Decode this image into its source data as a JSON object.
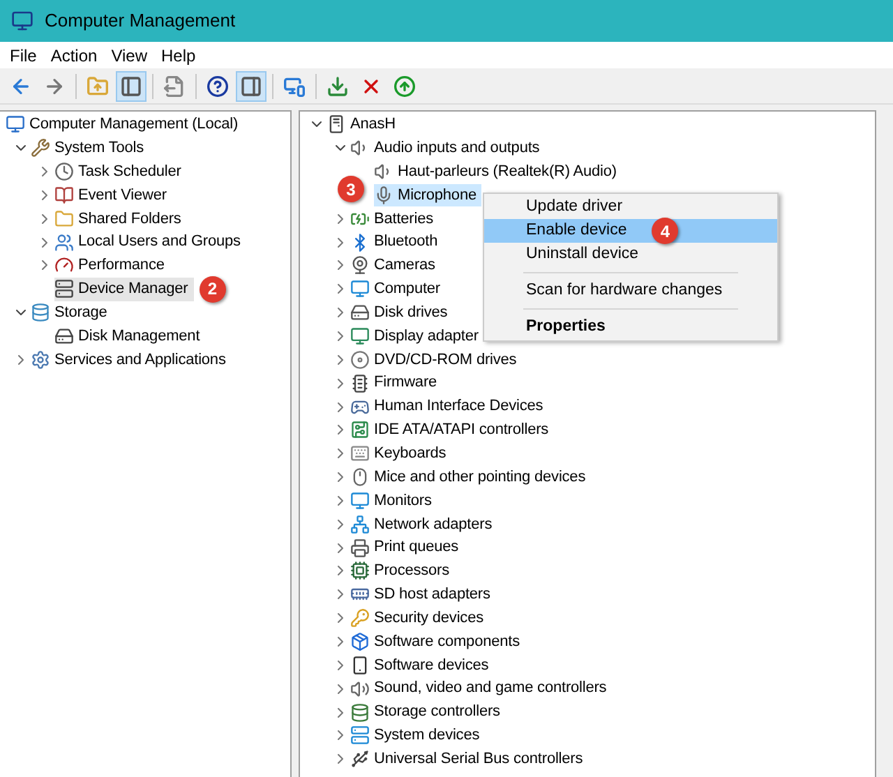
{
  "window": {
    "title": "Computer Management"
  },
  "menu": [
    "File",
    "Action",
    "View",
    "Help"
  ],
  "toolbar": [
    {
      "pressed": false
    },
    {
      "pressed": false
    },
    {
      "pressed": false
    },
    {
      "pressed": true
    },
    {
      "pressed": false
    },
    {
      "pressed": false
    },
    {
      "pressed": true
    },
    {
      "pressed": false
    },
    {
      "pressed": false
    },
    {
      "pressed": false
    },
    {
      "pressed": false
    }
  ],
  "left_tree": [
    {
      "label": "Computer Management (Local)",
      "selected": false,
      "children": [
        {
          "label": "System Tools",
          "selected": false,
          "expanded": true,
          "children": [
            {
              "label": "Task Scheduler",
              "selected": false,
              "expanded": false
            },
            {
              "label": "Event Viewer",
              "selected": false,
              "expanded": false
            },
            {
              "label": "Shared Folders",
              "selected": false,
              "expanded": false
            },
            {
              "label": "Local Users and Groups",
              "selected": false,
              "expanded": false
            },
            {
              "label": "Performance",
              "selected": false,
              "expanded": false
            },
            {
              "label": "Device Manager",
              "selected": true,
              "badge": "2",
              "badge_first": false
            }
          ]
        },
        {
          "label": "Storage",
          "selected": false,
          "expanded": true,
          "children": [
            {
              "label": "Disk Management",
              "selected": false
            }
          ]
        },
        {
          "label": "Services and Applications",
          "selected": false,
          "expanded": false
        }
      ]
    }
  ],
  "right_tree": [
    {
      "label": "AnasH",
      "selected": false,
      "expanded": true,
      "children": [
        {
          "label": "Audio inputs and outputs",
          "selected": false,
          "expanded": true,
          "children": [
            {
              "label": "Haut-parleurs (Realtek(R) Audio)",
              "selected": false
            },
            {
              "label": "Microphone",
              "selected": true,
              "badge": "3",
              "badge_first": true
            }
          ]
        },
        {
          "label": "Batteries",
          "selected": false,
          "expanded": false
        },
        {
          "label": "Bluetooth",
          "selected": false,
          "expanded": false
        },
        {
          "label": "Cameras",
          "selected": false,
          "expanded": false
        },
        {
          "label": "Computer",
          "selected": false,
          "expanded": false
        },
        {
          "label": "Disk drives",
          "selected": false,
          "expanded": false
        },
        {
          "label": "Display adapter",
          "selected": false,
          "expanded": false
        },
        {
          "label": "DVD/CD-ROM drives",
          "selected": false,
          "expanded": false
        },
        {
          "label": "Firmware",
          "selected": false,
          "expanded": false
        },
        {
          "label": "Human Interface Devices",
          "selected": false,
          "expanded": false
        },
        {
          "label": "IDE ATA/ATAPI controllers",
          "selected": false,
          "expanded": false
        },
        {
          "label": "Keyboards",
          "selected": false,
          "expanded": false
        },
        {
          "label": "Mice and other pointing devices",
          "selected": false,
          "expanded": false
        },
        {
          "label": "Monitors",
          "selected": false,
          "expanded": false
        },
        {
          "label": "Network adapters",
          "selected": false,
          "expanded": false
        },
        {
          "label": "Print queues",
          "selected": false,
          "expanded": false
        },
        {
          "label": "Processors",
          "selected": false,
          "expanded": false
        },
        {
          "label": "SD host adapters",
          "selected": false,
          "expanded": false
        },
        {
          "label": "Security devices",
          "selected": false,
          "expanded": false
        },
        {
          "label": "Software components",
          "selected": false,
          "expanded": false
        },
        {
          "label": "Software devices",
          "selected": false,
          "expanded": false
        },
        {
          "label": "Sound, video and game controllers",
          "selected": false,
          "expanded": false
        },
        {
          "label": "Storage controllers",
          "selected": false,
          "expanded": false
        },
        {
          "label": "System devices",
          "selected": false,
          "expanded": false
        },
        {
          "label": "Universal Serial Bus controllers",
          "selected": false,
          "expanded": false
        }
      ]
    }
  ],
  "context_menu": [
    {
      "kind": "item",
      "label": "Update driver",
      "selected": false,
      "default": false
    },
    {
      "kind": "item",
      "label": "Enable device",
      "selected": true,
      "default": false,
      "badge": "4"
    },
    {
      "kind": "item",
      "label": "Uninstall device",
      "selected": false,
      "default": false
    },
    {
      "kind": "separator"
    },
    {
      "kind": "item",
      "label": "Scan for hardware changes",
      "selected": false,
      "default": false
    },
    {
      "kind": "separator"
    },
    {
      "kind": "item",
      "label": "Properties",
      "selected": false,
      "default": true
    }
  ]
}
